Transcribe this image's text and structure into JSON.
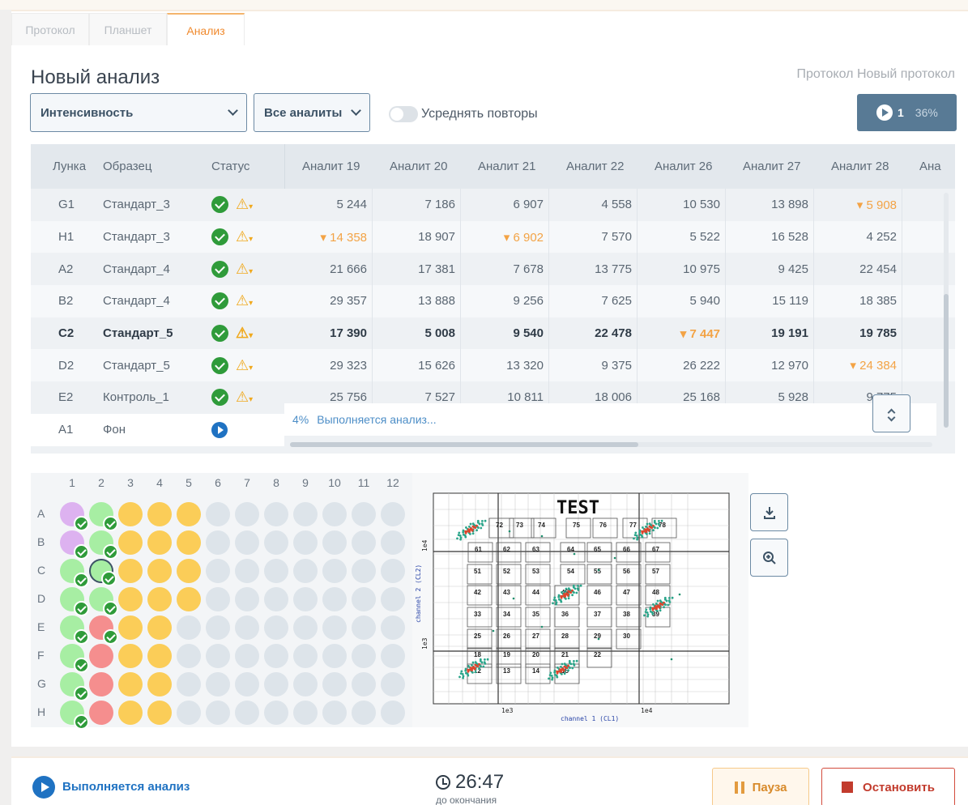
{
  "tabs": [
    {
      "label": "Протокол"
    },
    {
      "label": "Планшет"
    },
    {
      "label": "Анализ"
    }
  ],
  "title": "Новый анализ",
  "protocol_label": "Протокол Новый протокол",
  "controls": {
    "metric_select": "Интенсивность",
    "analyte_select": "Все аналиты",
    "average_toggle_label": "Усреднять повторы",
    "average_toggle_on": false,
    "run_count": "1",
    "run_progress": "36%"
  },
  "table": {
    "headers": {
      "well": "Лунка",
      "sample": "Образец",
      "status": "Статус"
    },
    "analytes": [
      "Аналит 19",
      "Аналит 20",
      "Аналит 21",
      "Аналит 22",
      "Аналит 26",
      "Аналит 27",
      "Аналит 28",
      "Ана"
    ],
    "rows": [
      {
        "well": "G1",
        "sample": "Стандарт_3",
        "bold": false,
        "values": [
          "5 244",
          "7 186",
          "6 907",
          "4 558",
          "10 530",
          "13 898",
          "▾ 5 908"
        ],
        "flags": [
          false,
          false,
          false,
          false,
          false,
          false,
          true
        ]
      },
      {
        "well": "H1",
        "sample": "Стандарт_3",
        "bold": false,
        "values": [
          "▾ 14 358",
          "18 907",
          "▾ 6 902",
          "7 570",
          "5 522",
          "16 528",
          "4 252"
        ],
        "flags": [
          true,
          false,
          true,
          false,
          false,
          false,
          false
        ]
      },
      {
        "well": "A2",
        "sample": "Стандарт_4",
        "bold": false,
        "values": [
          "21 666",
          "17 381",
          "7 678",
          "13 775",
          "10 975",
          "9 425",
          "22 454"
        ],
        "flags": [
          false,
          false,
          false,
          false,
          false,
          false,
          false
        ]
      },
      {
        "well": "B2",
        "sample": "Стандарт_4",
        "bold": false,
        "values": [
          "29 357",
          "13 888",
          "9 256",
          "7 625",
          "5 940",
          "15 119",
          "18 385"
        ],
        "flags": [
          false,
          false,
          false,
          false,
          false,
          false,
          false
        ]
      },
      {
        "well": "C2",
        "sample": "Стандарт_5",
        "bold": true,
        "values": [
          "17 390",
          "5 008",
          "9 540",
          "22 478",
          "▾ 7 447",
          "19 191",
          "19 785"
        ],
        "flags": [
          false,
          false,
          false,
          false,
          true,
          false,
          false
        ]
      },
      {
        "well": "D2",
        "sample": "Стандарт_5",
        "bold": false,
        "values": [
          "29 323",
          "15 626",
          "13 320",
          "9 375",
          "26 222",
          "12 970",
          "▾ 24 384"
        ],
        "flags": [
          false,
          false,
          false,
          false,
          false,
          false,
          true
        ]
      },
      {
        "well": "E2",
        "sample": "Контроль_1",
        "bold": false,
        "values": [
          "25 756",
          "7 527",
          "10 811",
          "18 006",
          "25 168",
          "5 928",
          "9 775"
        ],
        "flags": [
          false,
          false,
          false,
          false,
          false,
          false,
          false
        ]
      }
    ],
    "running_row": {
      "well": "A1",
      "sample": "Фон",
      "progress": "4%",
      "message": "Выполняется анализ..."
    }
  },
  "plate": {
    "columns": [
      "1",
      "2",
      "3",
      "4",
      "5",
      "6",
      "7",
      "8",
      "9",
      "10",
      "11",
      "12"
    ],
    "rows": [
      "A",
      "B",
      "C",
      "D",
      "E",
      "F",
      "G",
      "H"
    ]
  },
  "plot": {
    "title": "TEST",
    "xlabel": "channel 1 (CL1)",
    "ylabel": "channel 2 (CL2)",
    "x_ticks": [
      "1e3",
      "1e4"
    ],
    "y_ticks": [
      "1e4",
      "1e3"
    ],
    "bead_ids": [
      "72",
      "73",
      "74",
      "75",
      "76",
      "77",
      "78",
      "61",
      "62",
      "63",
      "64",
      "65",
      "66",
      "67",
      "51",
      "52",
      "53",
      "54",
      "55",
      "56",
      "57",
      "42",
      "43",
      "44",
      "45",
      "46",
      "47",
      "48",
      "33",
      "34",
      "35",
      "36",
      "37",
      "38",
      "39",
      "25",
      "26",
      "27",
      "28",
      "29",
      "30",
      "18",
      "19",
      "20",
      "21",
      "22",
      "12",
      "13",
      "14",
      "15"
    ]
  },
  "footer": {
    "status": "Выполняется анализ",
    "time": "26:47",
    "time_sub": "до окончания",
    "pause": "Пауза",
    "stop": "Остановить"
  },
  "colors": {
    "accent": "#f08a2e",
    "primary": "#587a95",
    "ok": "#2f9b3a",
    "warn": "#f0a91e",
    "running": "#1f72c2",
    "stop": "#c23b2d"
  }
}
